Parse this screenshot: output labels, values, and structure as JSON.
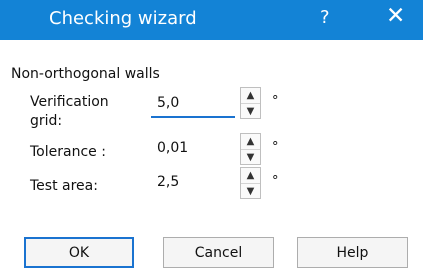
{
  "window": {
    "title": "Checking wizard",
    "help_glyph": "?",
    "close_glyph": "✕"
  },
  "group": {
    "label": "Non-orthogonal walls"
  },
  "fields": [
    {
      "label_line1": "Verification",
      "label_line2": "grid:",
      "value": "5,0",
      "unit": "°"
    },
    {
      "label": "Tolerance :",
      "value": "0,01",
      "unit": "°"
    },
    {
      "label": "Test area:",
      "value": "2,5",
      "unit": "°"
    }
  ],
  "spinner": {
    "up": "▲",
    "down": "▼"
  },
  "buttons": {
    "ok": "OK",
    "cancel": "Cancel",
    "help": "Help"
  },
  "colors": {
    "titlebar": "#1383d6",
    "focus_accent": "#1a73d0"
  }
}
